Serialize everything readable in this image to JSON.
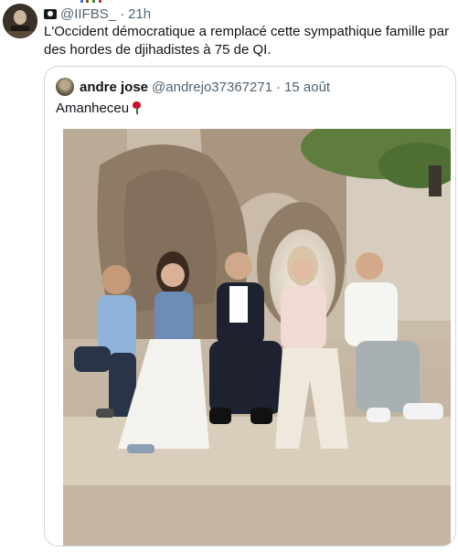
{
  "tweet": {
    "handle": "@IIFBS_",
    "separator": "·",
    "time": "21h",
    "text": "L'Occident démocratique a remplacé cette sympathique famille par des hordes de djihadistes à 75 de QI."
  },
  "quote": {
    "name": "andre jose",
    "handle": "@andrejo37367271",
    "separator": "·",
    "date": "15 août",
    "text": "Amanheceu"
  },
  "icons": {
    "header_emoji": "pirate-flag-icon",
    "quote_emoji": "rose-icon"
  }
}
